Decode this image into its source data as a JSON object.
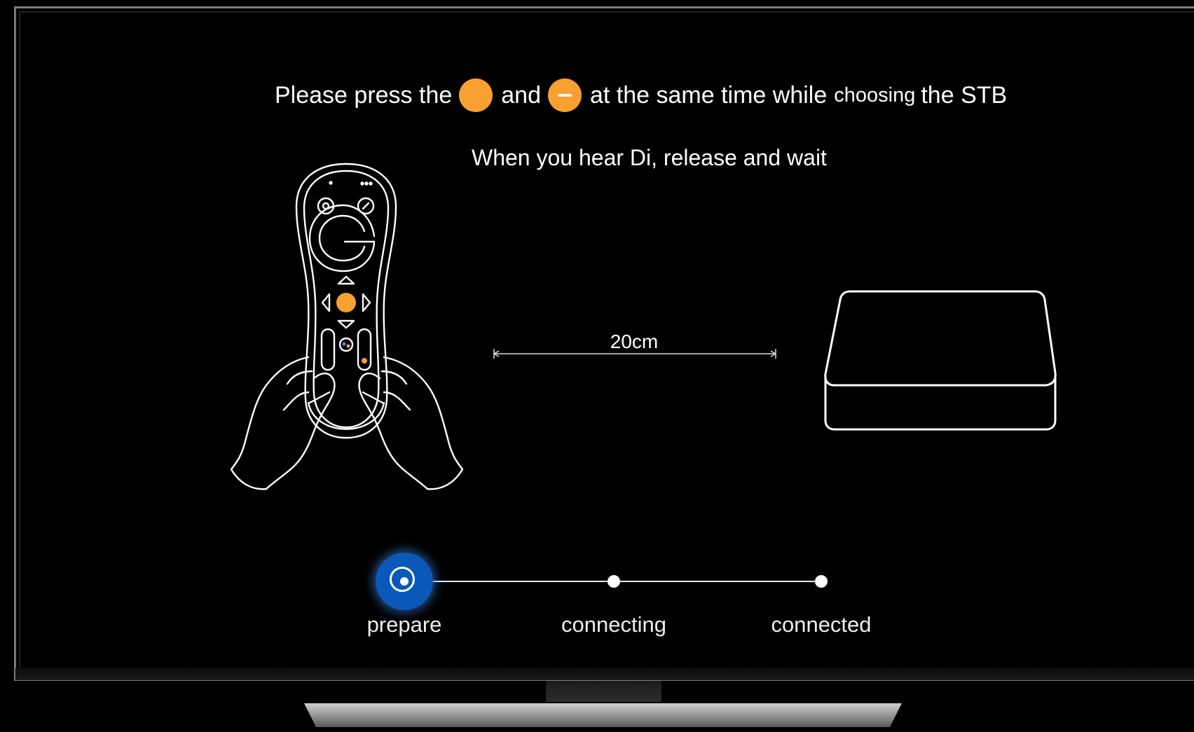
{
  "instruction": {
    "part1": "Please press the",
    "part2": "and",
    "part3": "at the same time while",
    "part4": "choosing",
    "part5": "the STB",
    "sub": "When you hear Di, release and wait"
  },
  "distance_label": "20cm",
  "steps": [
    {
      "label": "prepare",
      "state": "active"
    },
    {
      "label": "connecting",
      "state": "pending"
    },
    {
      "label": "connected",
      "state": "pending"
    }
  ],
  "colors": {
    "accent_orange": "#f8a030",
    "active_blue": "#0a58b8"
  },
  "icons": [
    "orange-button-icon",
    "minus-button-icon",
    "remote-in-hands-illustration",
    "set-top-box-illustration"
  ]
}
